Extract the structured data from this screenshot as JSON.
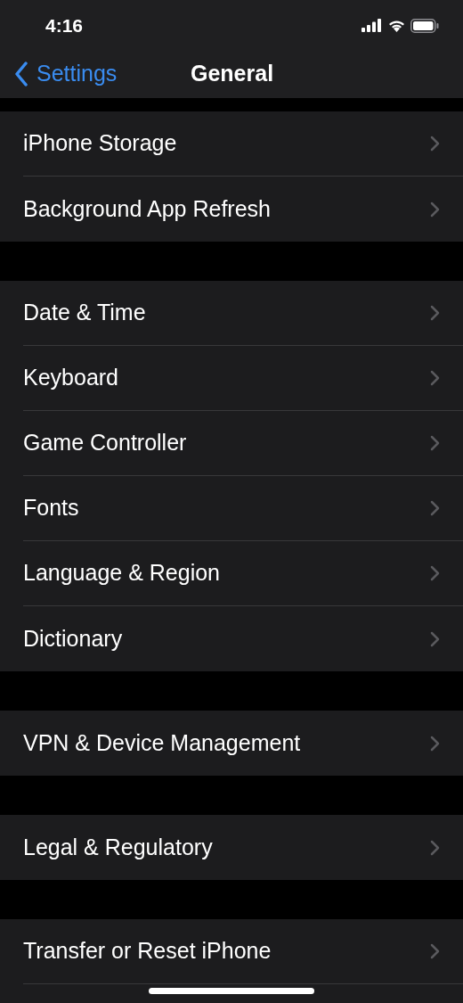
{
  "status_bar": {
    "time": "4:16"
  },
  "nav": {
    "back": "Settings",
    "title": "General"
  },
  "groups": [
    {
      "items": [
        "iPhone Storage",
        "Background App Refresh"
      ]
    },
    {
      "items": [
        "Date & Time",
        "Keyboard",
        "Game Controller",
        "Fonts",
        "Language & Region",
        "Dictionary"
      ]
    },
    {
      "items": [
        "VPN & Device Management"
      ]
    },
    {
      "items": [
        "Legal & Regulatory"
      ]
    },
    {
      "items": [
        "Transfer or Reset iPhone"
      ]
    }
  ]
}
